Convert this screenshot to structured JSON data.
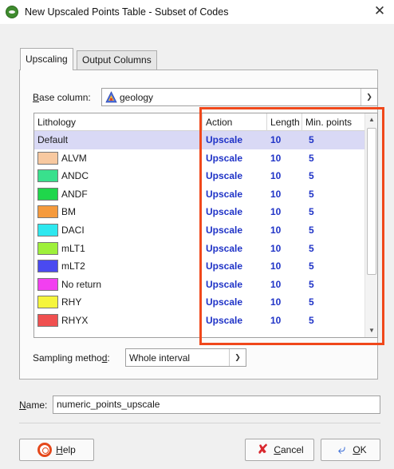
{
  "window": {
    "title": "New Upscaled Points Table - Subset of Codes",
    "close_glyph": "✕"
  },
  "tabs": [
    {
      "label": "Upscaling",
      "active": true
    },
    {
      "label": "Output Columns",
      "active": false
    }
  ],
  "base_column": {
    "label_first": "B",
    "label_rest": "ase column:",
    "value": "geology",
    "icon": "categorical-column-icon"
  },
  "table": {
    "headers": {
      "lithology": "Lithology",
      "action": "Action",
      "length": "Length",
      "min_points": "Min. points"
    },
    "rows": [
      {
        "lithology": "Default",
        "color": "",
        "action": "Upscale",
        "length": "10",
        "min_points": "5",
        "selected": true
      },
      {
        "lithology": "ALVM",
        "color": "#f8c9a0",
        "action": "Upscale",
        "length": "10",
        "min_points": "5"
      },
      {
        "lithology": "ANDC",
        "color": "#39e08d",
        "action": "Upscale",
        "length": "10",
        "min_points": "5"
      },
      {
        "lithology": "ANDF",
        "color": "#1fd64b",
        "action": "Upscale",
        "length": "10",
        "min_points": "5"
      },
      {
        "lithology": "BM",
        "color": "#f59a3c",
        "action": "Upscale",
        "length": "10",
        "min_points": "5"
      },
      {
        "lithology": "DACI",
        "color": "#2ee8ef",
        "action": "Upscale",
        "length": "10",
        "min_points": "5"
      },
      {
        "lithology": "mLT1",
        "color": "#9ef03a",
        "action": "Upscale",
        "length": "10",
        "min_points": "5"
      },
      {
        "lithology": "mLT2",
        "color": "#4a4af0",
        "action": "Upscale",
        "length": "10",
        "min_points": "5"
      },
      {
        "lithology": "No return",
        "color": "#f23ff0",
        "action": "Upscale",
        "length": "10",
        "min_points": "5"
      },
      {
        "lithology": "RHY",
        "color": "#f5f53c",
        "action": "Upscale",
        "length": "10",
        "min_points": "5"
      },
      {
        "lithology": "RHYX",
        "color": "#f05050",
        "action": "Upscale",
        "length": "10",
        "min_points": "5"
      }
    ]
  },
  "sampling_method": {
    "label_before": "Sampling metho",
    "label_underlined": "d",
    "label_after": ":",
    "value": "Whole interval"
  },
  "name_field": {
    "label_underlined": "N",
    "label_rest": "ame:",
    "value": "numeric_points_upscale"
  },
  "buttons": {
    "help": {
      "underlined": "H",
      "rest": "elp"
    },
    "cancel": {
      "underlined": "C",
      "rest": "ancel"
    },
    "ok": {
      "underlined": "O",
      "rest": "K"
    }
  },
  "colors": {
    "accent_text": "#1f33c7",
    "highlight_border": "#f0481b",
    "selected_row": "#d9d9f5"
  }
}
